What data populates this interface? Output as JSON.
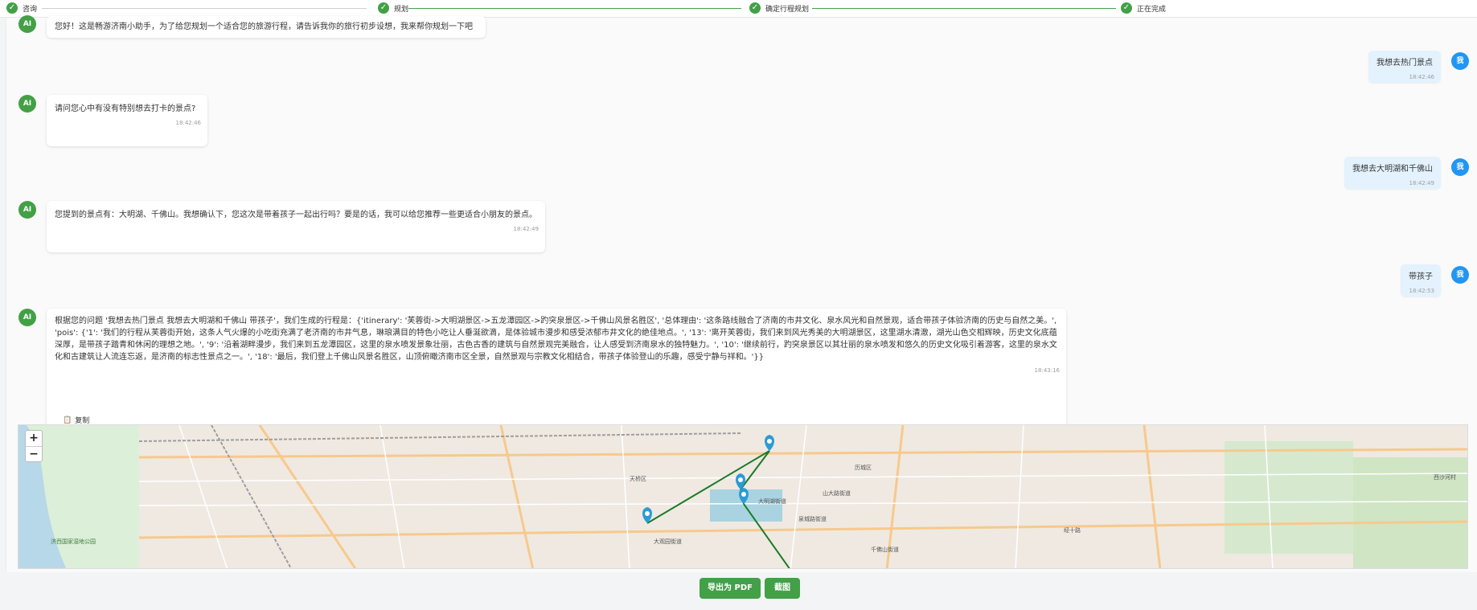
{
  "steps": [
    {
      "label": "咨询"
    },
    {
      "label": "规划"
    },
    {
      "label": "确定行程规划"
    },
    {
      "label": "正在完成"
    }
  ],
  "avatars": {
    "ai": "AI",
    "me": "我"
  },
  "messages": [
    {
      "role": "ai",
      "text": "您好！这是畅游济南小助手，为了给您规划一个适合您的旅游行程，请告诉我你的旅行初步设想，我来帮你规划一下吧",
      "time": ""
    },
    {
      "role": "me",
      "text": "我想去热门景点",
      "time": "18:42:46"
    },
    {
      "role": "ai",
      "text": "请问您心中有没有特别想去打卡的景点?",
      "time": "18:42:46"
    },
    {
      "role": "me",
      "text": "我想去大明湖和千佛山",
      "time": "18:42:49"
    },
    {
      "role": "ai",
      "text": "您提到的景点有：大明湖、千佛山。我想确认下，您这次是带着孩子一起出行吗？要是的话，我可以给您推荐一些更适合小朋友的景点。",
      "time": "18:42:49"
    },
    {
      "role": "me",
      "text": "带孩子",
      "time": "18:42:53"
    },
    {
      "role": "ai",
      "text": "根据您的问题 '我想去热门景点 我想去大明湖和千佛山 带孩子'，我们生成的行程是：{'itinerary': '芙蓉街->大明湖景区->五龙潭园区->趵突泉景区->千佛山风景名胜区', '总体理由': '这条路线融合了济南的市井文化、泉水风光和自然景观，适合带孩子体验济南的历史与自然之美。', 'pois': {'1': '我们的行程从芙蓉街开始，这条人气火爆的小吃街充满了老济南的市井气息，琳琅满目的特色小吃让人垂涎欲滴，是体验城市漫步和感受浓郁市井文化的绝佳地点。', '13': '离开芙蓉街，我们来到风光秀美的大明湖景区，这里湖水清澈，湖光山色交相辉映，历史文化底蕴深厚，是带孩子踏青和休闲的理想之地。', '9': '沿着湖畔漫步，我们来到五龙潭园区，这里的泉水喷发景象壮丽，古色古香的建筑与自然景观完美融合，让人感受到济南泉水的独特魅力。', '10': '继续前行，趵突泉景区以其壮丽的泉水喷发和悠久的历史文化吸引着游客，这里的泉水文化和古建筑让人流连忘返，是济南的标志性景点之一。', '18': '最后，我们登上千佛山风景名胜区，山顶俯瞰济南市区全景，自然景观与宗教文化相结合，带孩子体验登山的乐趣，感受宁静与祥和。'}}",
      "time": "18:43:16"
    }
  ],
  "copy_label": "复制",
  "map": {
    "zoom_in": "+",
    "zoom_out": "−",
    "labels": [
      "天桥区",
      "历城区",
      "济西国家湿地公园",
      "大明湖街道",
      "泉城路街道",
      "大观园街道",
      "西沙河村",
      "山大路街道",
      "经十路",
      "千佛山街道"
    ],
    "route_color": "#1b7a2a",
    "marker_color": "#2b9bd6"
  },
  "buttons": {
    "export_pdf": "导出为 PDF",
    "screenshot": "截图"
  }
}
